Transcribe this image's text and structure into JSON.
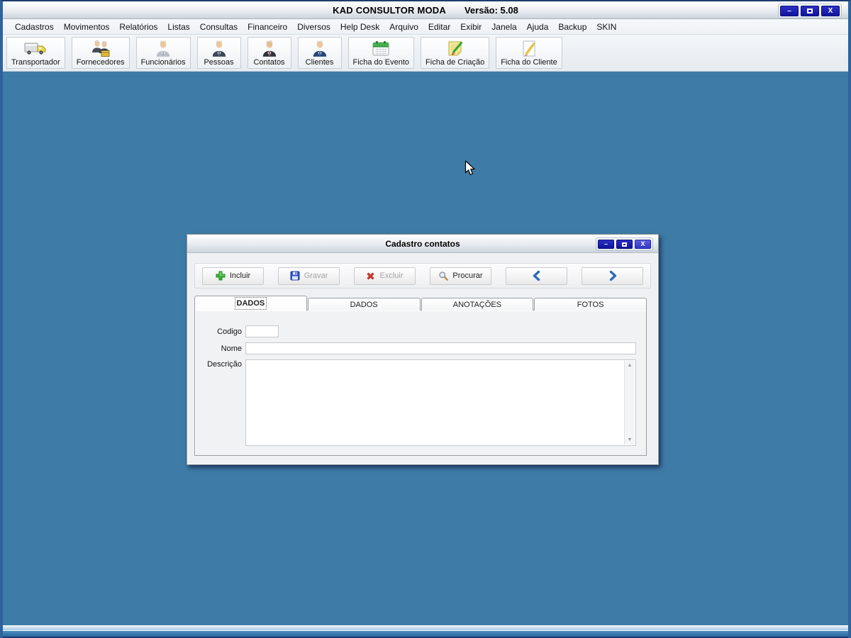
{
  "app": {
    "title": "KAD CONSULTOR MODA",
    "version": "Versão: 5.08",
    "controls": {
      "minimize_glyph": "–",
      "close_glyph": "X"
    }
  },
  "menu": {
    "items": [
      {
        "label": "Cadastros"
      },
      {
        "label": "Movimentos"
      },
      {
        "label": "Relatórios"
      },
      {
        "label": "Listas"
      },
      {
        "label": "Consultas"
      },
      {
        "label": "Financeiro"
      },
      {
        "label": "Diversos"
      },
      {
        "label": "Help Desk"
      },
      {
        "label": "Arquivo"
      },
      {
        "label": "Editar"
      },
      {
        "label": "Exibir"
      },
      {
        "label": "Janela"
      },
      {
        "label": "Ajuda"
      },
      {
        "label": "Backup"
      },
      {
        "label": "SKIN"
      }
    ]
  },
  "toolbar": {
    "buttons": [
      {
        "label": "Transportador",
        "icon": "truck-icon"
      },
      {
        "label": "Fornecedores",
        "icon": "suppliers-icon"
      },
      {
        "label": "Funcionários",
        "icon": "employee-icon"
      },
      {
        "label": "Pessoas",
        "icon": "person-icon"
      },
      {
        "label": "Contatos",
        "icon": "contact-icon"
      },
      {
        "label": "Clientes",
        "icon": "client-icon"
      },
      {
        "label": "Ficha do Evento",
        "icon": "event-calendar-icon"
      },
      {
        "label": "Ficha de Criação",
        "icon": "creation-note-icon"
      },
      {
        "label": "Ficha do Cliente",
        "icon": "client-card-icon"
      }
    ]
  },
  "dialog": {
    "title": "Cadastro contatos",
    "controls": {
      "minimize_glyph": "–",
      "close_glyph": "X"
    },
    "actions": {
      "incluir": "Incluir",
      "gravar": "Gravar",
      "excluir": "Excluir",
      "procurar": "Procurar"
    },
    "tabs": [
      {
        "label": "DADOS",
        "active": true
      },
      {
        "label": "DADOS",
        "active": false
      },
      {
        "label": "ANOTAÇÕES",
        "active": false
      },
      {
        "label": "FOTOS",
        "active": false
      }
    ],
    "form": {
      "codigo_label": "Codigo",
      "codigo_value": "",
      "nome_label": "Nome",
      "nome_value": "",
      "descricao_label": "Descrição",
      "descricao_value": ""
    }
  },
  "colors": {
    "mdi_background": "#3e7ba6",
    "window_button_blue": "#1c20b2",
    "nav_arrow_blue": "#2a6cbb",
    "disabled_text": "#a3a3a3"
  }
}
